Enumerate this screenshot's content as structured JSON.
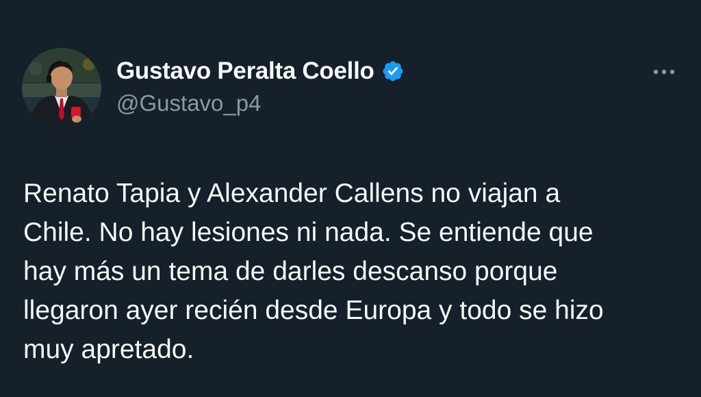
{
  "tweet": {
    "author": {
      "display_name": "Gustavo Peralta Coello",
      "handle": "@Gustavo_p4",
      "verified": true,
      "avatar_icon": "profile-photo",
      "verified_icon": "verified-badge-icon"
    },
    "more_icon": "more-options-icon",
    "text_lines": [
      "Renato Tapia y Alexander Callens no viajan a",
      "Chile. No hay lesiones ni nada. Se entiende que",
      "hay más un tema de darles descanso porque",
      "llegaron ayer recién desde Europa y todo se hizo",
      "muy apretado."
    ]
  },
  "colors": {
    "background": "#15202b",
    "text_primary": "#f7f9f9",
    "text_secondary": "#8b98a5",
    "verified_blue": "#1d9bf0"
  }
}
